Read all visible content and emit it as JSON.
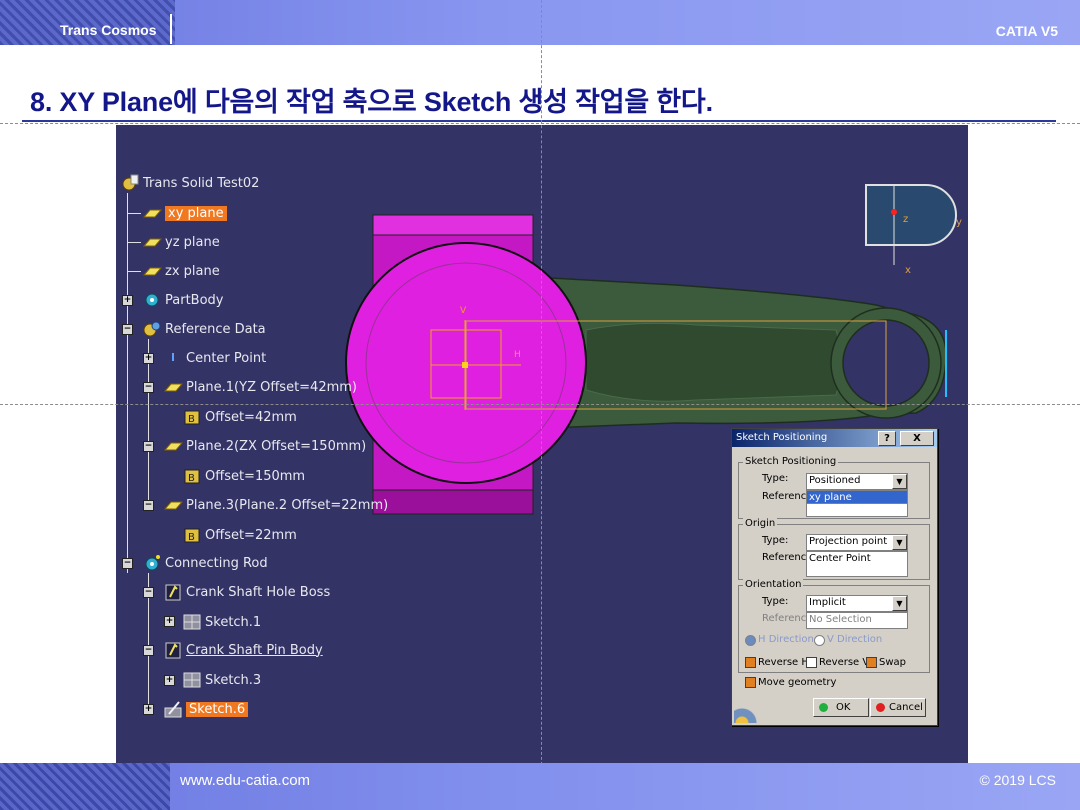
{
  "slide": {
    "brand": "Trans Cosmos",
    "app_label": "CATIA V5",
    "title": "8. XY Plane에 다음의 작업 축으로 Sketch 생성 작업을 한다.",
    "footer_url": "www.edu-catia.com",
    "footer_copyright": "© 2019 LCS"
  },
  "tree": {
    "root": "Trans Solid Test02",
    "xy_plane": "xy plane",
    "yz_plane": "yz plane",
    "zx_plane": "zx plane",
    "part_body": "PartBody",
    "reference_data": "Reference Data",
    "center_point": "Center Point",
    "plane1": "Plane.1(YZ Offset=42mm)",
    "plane1_offset": "Offset=42mm",
    "plane2": "Plane.2(ZX Offset=150mm)",
    "plane2_offset": "Offset=150mm",
    "plane3": "Plane.3(Plane.2 Offset=22mm)",
    "plane3_offset": "Offset=22mm",
    "connecting_rod": "Connecting Rod",
    "crank_boss": "Crank Shaft Hole Boss",
    "sketch1": "Sketch.1",
    "crank_pin": "Crank Shaft Pin Body",
    "sketch3": "Sketch.3",
    "sketch6": "Sketch.6"
  },
  "viewport": {
    "compass_z": "z",
    "compass_y": "y",
    "compass_x": "x",
    "axis_v": "V",
    "axis_h": "H"
  },
  "dialog": {
    "title": "Sketch Positioning",
    "help_btn": "?",
    "close_btn": "X",
    "sp_group": "Sketch Positioning",
    "type_label": "Type:",
    "reference_label": "Reference:",
    "sp_type": "Positioned",
    "sp_reference": "xy plane",
    "origin_group": "Origin",
    "origin_type": "Projection point",
    "origin_reference": "Center Point",
    "orientation_group": "Orientation",
    "orientation_type": "Implicit",
    "orientation_reference": "No Selection",
    "h_direction": "H Direction",
    "v_direction": "V Direction",
    "reverse_h": "Reverse H",
    "reverse_v": "Reverse V",
    "swap": "Swap",
    "move_geometry": "Move geometry",
    "ok": "OK",
    "cancel": "Cancel"
  },
  "colors": {
    "viewport_bg": "#333366",
    "highlight": "#f07820",
    "pin_fill": "#e020e0",
    "rod_fill": "#3c5a3c",
    "title": "#13178a"
  }
}
